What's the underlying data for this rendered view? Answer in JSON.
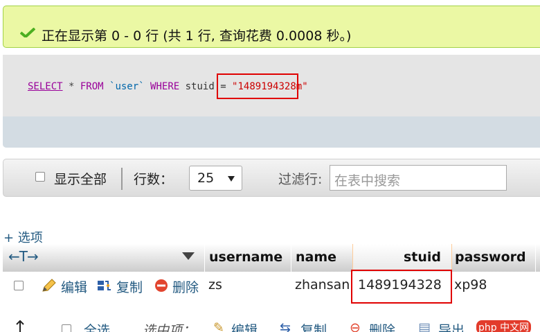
{
  "success": {
    "message": "正在显示第 0 - 0 行 (共 1 行, 查询花费 0.0008 秒。)"
  },
  "sql": {
    "select": "SELECT",
    "star": " * ",
    "from": "FROM",
    "table": " `user` ",
    "where": "WHERE",
    "column": " stuid = ",
    "value": "\"1489194328m\""
  },
  "toolbar": {
    "show_all_label": "显示全部",
    "rows_label": "行数：",
    "rows_value": "25",
    "filter_label": "过滤行:",
    "search_placeholder": "在表中搜索"
  },
  "options_link": "+ 选项",
  "table": {
    "arrows": "←T→",
    "columns": [
      "username",
      "name",
      "stuid",
      "password"
    ],
    "row": {
      "edit_label": "编辑",
      "copy_label": "复制",
      "delete_label": "删除",
      "username": "zs",
      "name": "zhansan",
      "stuid": "1489194328",
      "password": "xp98"
    }
  },
  "bottom_bar": {
    "select_all": "全选",
    "selected_label": "选中项：",
    "edit": "编辑",
    "copy": "复制",
    "delete": "删除",
    "export": "导出",
    "watermark": "php 中文网"
  },
  "colors": {
    "success_bg": "#ebf8a4",
    "link": "#235a81",
    "highlight": "#e00000",
    "sql_keyword": "#990099"
  }
}
